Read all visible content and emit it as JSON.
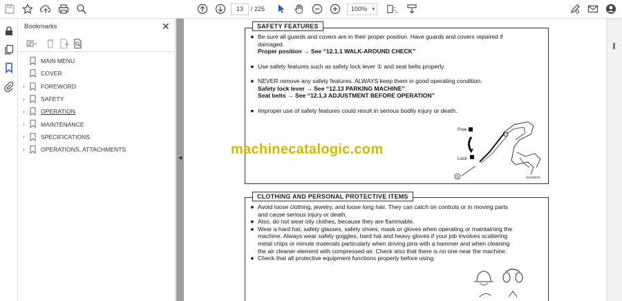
{
  "toolbar": {
    "page_current": "13",
    "page_total": "/ 225",
    "zoom": "100%"
  },
  "bookmarks": {
    "title": "Bookmarks",
    "items": [
      {
        "label": "MAIN MENU",
        "expandable": false
      },
      {
        "label": "COVER",
        "expandable": false
      },
      {
        "label": "FOREWORD",
        "expandable": true
      },
      {
        "label": "SAFETY",
        "expandable": true
      },
      {
        "label": "OPERATION",
        "expandable": true
      },
      {
        "label": "MAINTENANCE",
        "expandable": true
      },
      {
        "label": "SPECIFICATIONS",
        "expandable": true
      },
      {
        "label": "OPERATIONS, ATTACHMENTS",
        "expandable": true
      }
    ]
  },
  "document": {
    "safety": {
      "title": "SAFETY FEATURES",
      "b1_l1": "Be sure all guards and covers are in their proper position. Have guards and covers repaired if",
      "b1_l2": "damaged.",
      "b1_l3": "Proper position → See “12.1.1 WALK-AROUND CHECK”",
      "b2_l1": "Use safety features such as safety lock lever ① and seat belts properly.",
      "b3_l1": "NEVER remove any safety features. ALWAYS keep them in good operating condition.",
      "b3_l2": "Safety lock lever → See “12.13 PARKING MACHINE”",
      "b3_l3": "Seat belts → See “12.1.3 ADJUSTMENT BEFORE OPERATION”",
      "b4_l1": "Improper use of safety features could result in serious bodily injury or death.",
      "fig_free": "Free",
      "fig_lock": "Lock",
      "fig_num": "①",
      "fig_code": "SJA03570"
    },
    "watermark": "machinecatalogic.com",
    "clothing": {
      "title": "CLOTHING AND PERSONAL PROTECTIVE ITEMS",
      "b1_l1": "Avoid loose clothing, jewelry, and loose long hair. They can catch on controls or in moving parts",
      "b1_l2": "and cause serious injury or death.",
      "b2_l1": "Also, do not wear oily clothes, because they are flammable.",
      "b3_l1": "Wear a hard hat, safety glasses, safety shoes, mask or gloves when operating or maintaining the",
      "b3_l2": "machine. Always wear safety goggles, hard hat and heavy gloves if your job involves scattering",
      "b3_l3": "metal chips or minute materials particularly when driving pins with a hammer and when cleaning",
      "b3_l4": "the air cleaner element with compressed air. Check also that there is no one near the machine.",
      "b4_l1": "Check that all protective equipment functions properly before using."
    }
  }
}
